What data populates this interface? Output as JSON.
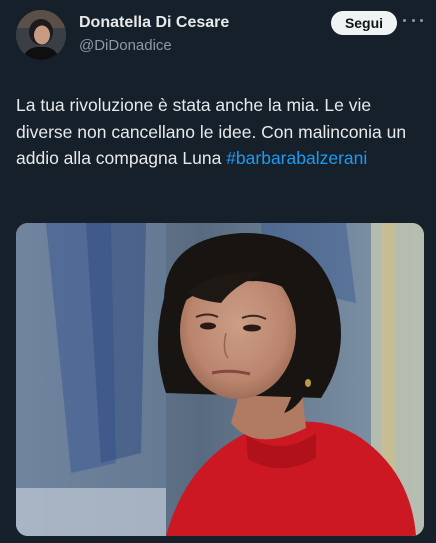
{
  "author": {
    "name": "Donatella Di Cesare",
    "handle": "@DiDonadice"
  },
  "follow_label": "Segui",
  "more_icon": "more-horizontal-icon",
  "tweet": {
    "text": "La tua rivoluzione è stata anche la mia. Le vie diverse non cancellano le idee. Con malinconia un addio alla compagna Luna",
    "hashtag": "#barbarabalzerani"
  },
  "colors": {
    "background": "#15202b",
    "primary_text": "#e7e9ea",
    "secondary_text": "#8b98a5",
    "link": "#1d9bf0",
    "follow_button_bg": "#eff3f4"
  }
}
